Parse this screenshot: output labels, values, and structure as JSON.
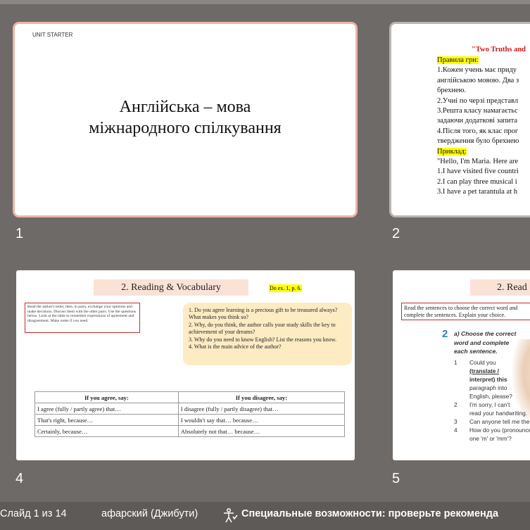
{
  "slides": [
    {
      "number": "1",
      "unit_label": "UNIT STARTER",
      "title_line1": "Англійська – мова",
      "title_line2": "міжнародного спілкування"
    },
    {
      "number": "2",
      "heading": "\"Two Truths and",
      "rules_label": "Правила гри:",
      "lines": [
        "1.Кожен учень має приду",
        "англійською мовою. Два з",
        "брехнею.",
        "2.Учні по черзі представл",
        "3.Решта класу намагаєтьс",
        "задаючи додаткові запита",
        "4.Після того, як клас прог",
        "твердження було брехнею"
      ],
      "example_label": "Приклад:",
      "example_lines": [
        "\"Hello, I'm Maria. Here are",
        "1.I have visited five countri",
        "2.I can play three musical i",
        "3.I have a pet tarantula at h"
      ]
    },
    {
      "number": "4",
      "heading": "2. Reading & Vocabulary",
      "do_ex": "Do ex. 1, p. 6.",
      "instructions": "Read the author's letter, then, in pairs, exchange your opinions and make decisions. Discuss them with the other pairs. Use the questions below. Look at the table to remember expressions of agreement and disagreement. Make notes if you need.",
      "questions": [
        "1. Do you agree learning is a precious gift to be treasured always? What makes you think so?",
        "2. Why, do you think, the author calls your study skills the key to achievement of your dreams?",
        "3. Why do you need to know English? List the reasons you know.",
        "4. What is the main advice of the author?"
      ],
      "table": {
        "headers": [
          "If you agree, say:",
          "If you disagree, say:"
        ],
        "rows": [
          [
            "I agree (fully / partly agree) that…",
            "I disagree (fully / partly disagree) that…"
          ],
          [
            "That's right, because…",
            "I wouldn't say that… because…"
          ],
          [
            "Certainly, because…",
            "Absolutely not that… because…"
          ]
        ]
      }
    },
    {
      "number": "5",
      "heading": "2. Read",
      "instructions_line1": "Read the sentences to choose the correct word and",
      "instructions_line2": "complete the sentences. Explain your choice.",
      "task_number": "2",
      "task_lines": [
        "a) Choose the correct",
        "word and complete",
        "each sentence."
      ],
      "items": [
        {
          "n": "1",
          "lines": [
            "Could you",
            "(translate /",
            "interpret) this",
            "paragraph into",
            "English, please?"
          ]
        },
        {
          "n": "2",
          "lines": [
            "I'm sorry, I can't",
            "read your handwriting."
          ]
        },
        {
          "n": "3",
          "lines": [
            "Can anyone tell me the"
          ]
        },
        {
          "n": "4",
          "lines": [
            "How do you (pronounce",
            "one 'm' or 'mm'?"
          ]
        }
      ]
    }
  ],
  "statusbar": {
    "slide_info": "Слайд 1 из 14",
    "language": "афарский (Джибути)",
    "accessibility": "Специальные возможности: проверьте рекоменда"
  },
  "colors": {
    "background": "#6e6a67",
    "selected_border": "#e9b5a7",
    "heading_fill": "#fbe2d7",
    "question_box": "#fdebc3",
    "highlight": "#ffff00",
    "red_text": "#d01919"
  }
}
